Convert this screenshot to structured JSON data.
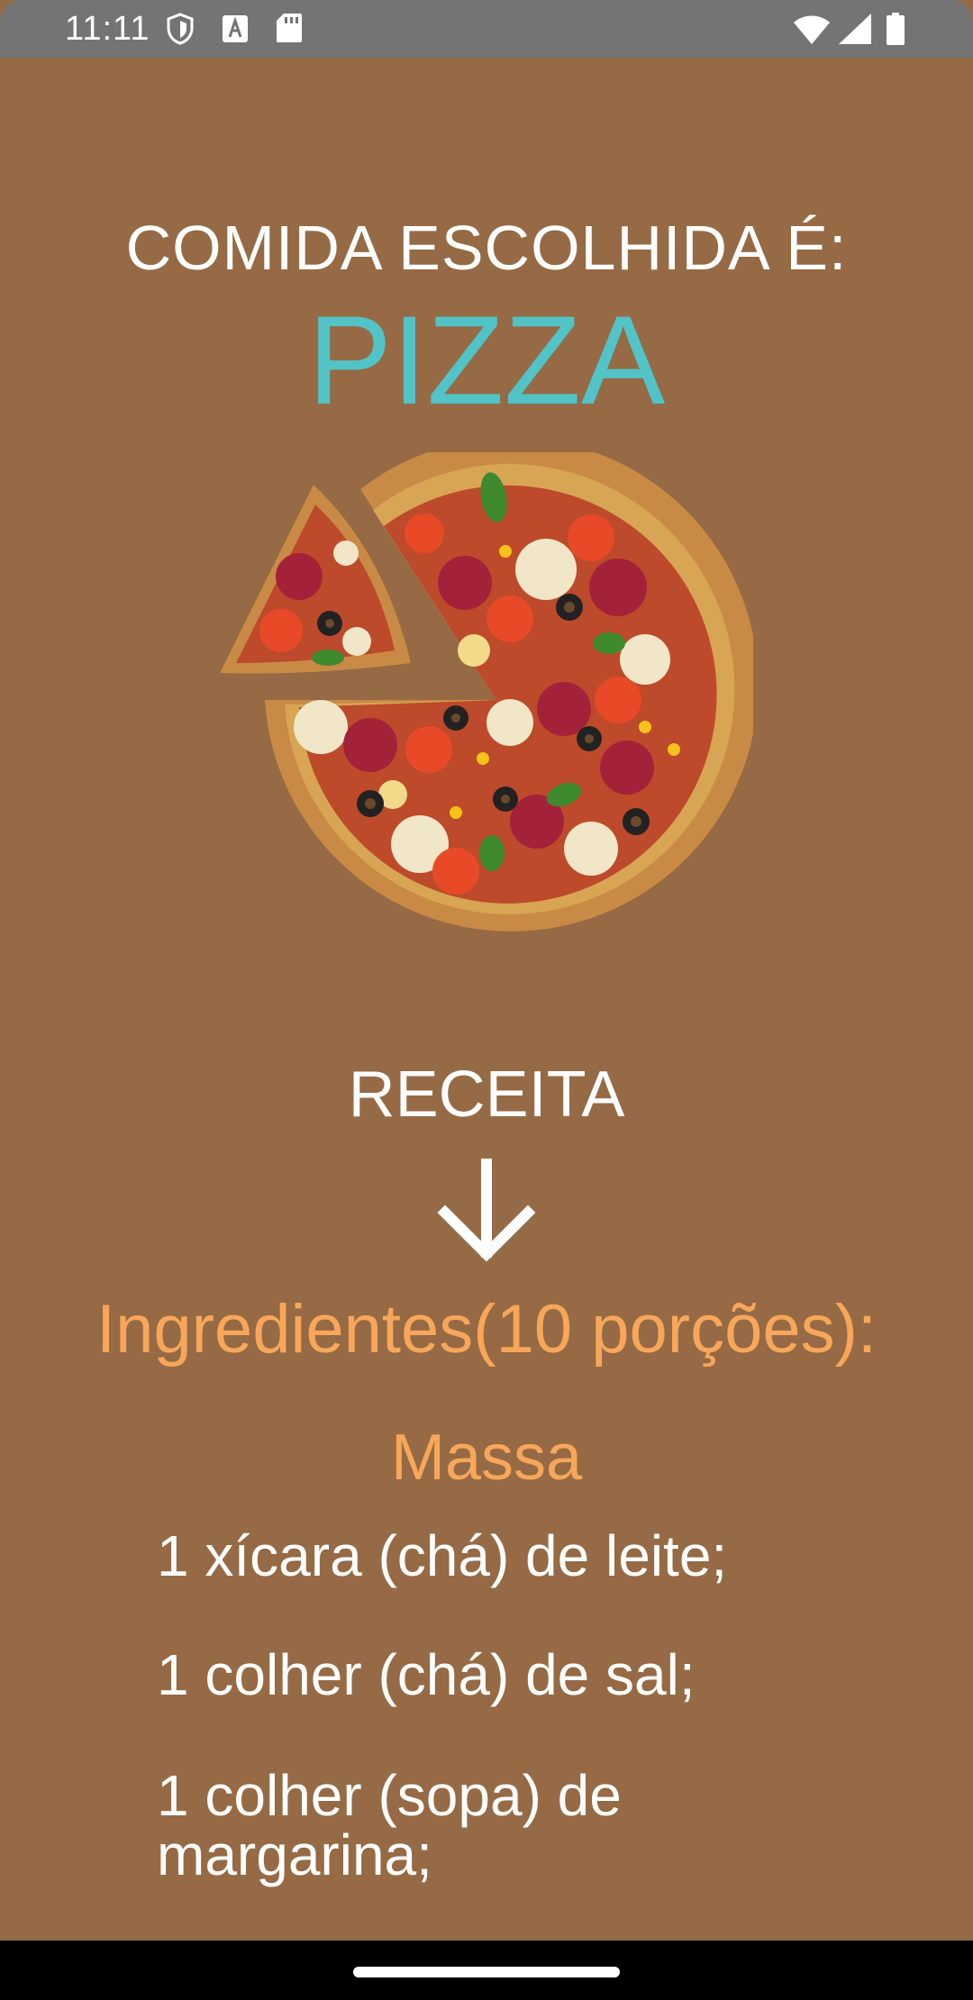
{
  "status_bar": {
    "time": "11:11",
    "left_icons": [
      "shield-icon",
      "a-box-icon",
      "sd-card-icon"
    ],
    "right_icons": [
      "wifi-icon",
      "signal-icon",
      "battery-icon"
    ]
  },
  "screen": {
    "heading": "COMIDA ESCOLHIDA É:",
    "food_name": "PIZZA",
    "image": "pizza-photo",
    "recipe_label": "RECEITA",
    "arrow_icon": "arrow-down-icon",
    "ingredients_title": "Ingredientes(10 porções):",
    "section_title": "Massa",
    "ingredients": [
      "1 xícara (chá) de leite;",
      "1 colher (chá) de sal;",
      "1 colher (sopa) de margarina;"
    ]
  },
  "colors": {
    "background": "#956a45",
    "status_bar": "#747474",
    "food_name": "#52c3c7",
    "accent_orange": "#f8a659",
    "text": "#ffffff"
  }
}
